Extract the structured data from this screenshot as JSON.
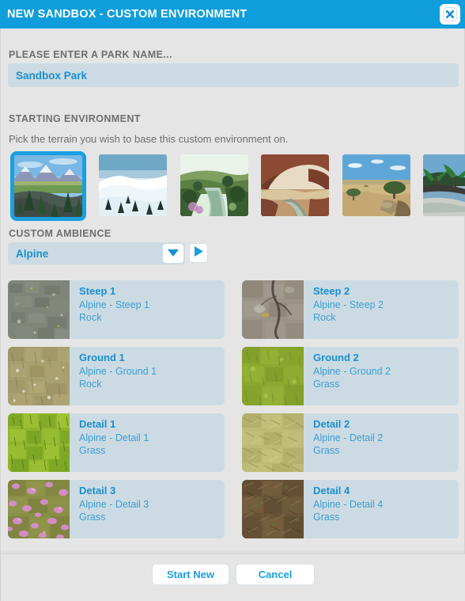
{
  "window": {
    "title": "NEW SANDBOX - CUSTOM ENVIRONMENT",
    "close_icon": "close-x-icon",
    "accent_color": "#0f9ddb",
    "body_color": "#e5e5e5",
    "field_color": "#ccdbe3",
    "link_color": "#1a8fd0"
  },
  "park": {
    "label": "PLEASE ENTER A PARK NAME...",
    "value": "Sandbox Park",
    "placeholder": "Sandbox Park"
  },
  "environment": {
    "label": "STARTING ENVIRONMENT",
    "help": "Pick the terrain you wish to base this custom environment on.",
    "selected_index": 0,
    "thumbnails": [
      {
        "name": "alpine-terrain-thumbnail",
        "selected": true
      },
      {
        "name": "snow-terrain-thumbnail",
        "selected": false
      },
      {
        "name": "temperate-river-terrain-thumbnail",
        "selected": false
      },
      {
        "name": "desert-arch-terrain-thumbnail",
        "selected": false
      },
      {
        "name": "savannah-terrain-thumbnail",
        "selected": false
      },
      {
        "name": "tropical-terrain-thumbnail",
        "selected": false
      }
    ]
  },
  "ambience": {
    "label": "CUSTOM AMBIENCE",
    "value": "Alpine",
    "caret_icon": "chevron-down-icon",
    "play_icon": "play-icon"
  },
  "textures": [
    {
      "name": "Steep 1",
      "path": "Alpine - Steep 1",
      "type": "Rock",
      "swatch": "rock-grey"
    },
    {
      "name": "Steep 2",
      "path": "Alpine - Steep 2",
      "type": "Rock",
      "swatch": "rock-cracked"
    },
    {
      "name": "Ground 1",
      "path": "Alpine - Ground 1",
      "type": "Rock",
      "swatch": "ground-tan"
    },
    {
      "name": "Ground 2",
      "path": "Alpine - Ground 2",
      "type": "Grass",
      "swatch": "grass-olive"
    },
    {
      "name": "Detail 1",
      "path": "Alpine - Detail 1",
      "type": "Grass",
      "swatch": "grass-bright"
    },
    {
      "name": "Detail 2",
      "path": "Alpine - Detail 2",
      "type": "Grass",
      "swatch": "grass-dry"
    },
    {
      "name": "Detail 3",
      "path": "Alpine - Detail 3",
      "type": "Grass",
      "swatch": "flowers-pink"
    },
    {
      "name": "Detail 4",
      "path": "Alpine - Detail 4",
      "type": "Grass",
      "swatch": "dirt-brown"
    }
  ],
  "footer": {
    "start_label": "Start New",
    "cancel_label": "Cancel"
  }
}
